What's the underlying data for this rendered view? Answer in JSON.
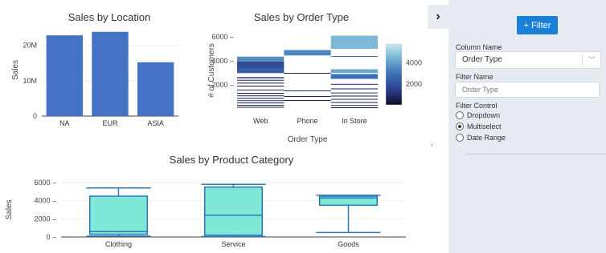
{
  "filter_panel": {
    "collapse_glyph": "›",
    "filter_button_label": "+ Filter",
    "column_name_label": "Column Name",
    "column_name_value": "Order Type",
    "filter_name_label": "Filter Name",
    "filter_name_placeholder": "Order Type",
    "filter_control_label": "Filter Control",
    "filter_controls": [
      {
        "label": "Dropdown",
        "selected": false
      },
      {
        "label": "Multiselect",
        "selected": true
      },
      {
        "label": "Date Range",
        "selected": false
      }
    ]
  },
  "chart_data": [
    {
      "type": "bar",
      "title": "Sales by Location",
      "ylabel": "Sales",
      "xlabel": "",
      "categories": [
        "NA",
        "EUR",
        "ASIA"
      ],
      "values": [
        22800000,
        23800000,
        15200000
      ],
      "ylim": [
        0,
        26000000
      ],
      "yticks": [
        0,
        10000000,
        20000000
      ],
      "ytick_labels": [
        "0",
        "10M",
        "20M"
      ],
      "color": "#4472c4"
    },
    {
      "type": "heatmap",
      "title": "Sales by Order Type",
      "xlabel": "Order Type",
      "ylabel": "# of Customers",
      "categories": [
        "Web",
        "Phone",
        "In Store"
      ],
      "ylim": [
        0,
        6400
      ],
      "yticks": [
        2000,
        4000,
        6000
      ],
      "ytick_labels": [
        "2000",
        "4000",
        "6000"
      ],
      "colorbar_ticks": [
        2000,
        4000
      ],
      "colorbar_range": [
        0,
        5800
      ],
      "colorscale": [
        "#0d0d2b",
        "#2c3f8c",
        "#3b6fb5",
        "#6fb0d1",
        "#c7e9f1"
      ],
      "cells": [
        {
          "col": 0,
          "y0": 3950,
          "y1": 4350,
          "value": 3600
        },
        {
          "col": 0,
          "y0": 3400,
          "y1": 3950,
          "value": 1800
        },
        {
          "col": 0,
          "y0": 2980,
          "y1": 3400,
          "value": 2400
        },
        {
          "col": 0,
          "y0": 2550,
          "y1": 2640,
          "value": 600
        },
        {
          "col": 0,
          "y0": 2350,
          "y1": 2420,
          "value": 900
        },
        {
          "col": 0,
          "y0": 2120,
          "y1": 2180,
          "value": 400
        },
        {
          "col": 0,
          "y0": 1860,
          "y1": 1930,
          "value": 500
        },
        {
          "col": 0,
          "y0": 1550,
          "y1": 1610,
          "value": 700
        },
        {
          "col": 0,
          "y0": 1280,
          "y1": 1330,
          "value": 300
        },
        {
          "col": 0,
          "y0": 1080,
          "y1": 1120,
          "value": 800
        },
        {
          "col": 0,
          "y0": 880,
          "y1": 910,
          "value": 400
        },
        {
          "col": 0,
          "y0": 690,
          "y1": 720,
          "value": 1100
        },
        {
          "col": 0,
          "y0": 500,
          "y1": 530,
          "value": 500
        },
        {
          "col": 0,
          "y0": 300,
          "y1": 330,
          "value": 900
        },
        {
          "col": 0,
          "y0": 140,
          "y1": 170,
          "value": 300
        },
        {
          "col": 1,
          "y0": 4450,
          "y1": 4900,
          "value": 3400
        },
        {
          "col": 1,
          "y0": 2960,
          "y1": 3000,
          "value": 700
        },
        {
          "col": 1,
          "y0": 1500,
          "y1": 1540,
          "value": 500
        },
        {
          "col": 1,
          "y0": 1040,
          "y1": 1070,
          "value": 400
        },
        {
          "col": 1,
          "y0": 700,
          "y1": 730,
          "value": 300
        },
        {
          "col": 2,
          "y0": 5000,
          "y1": 6100,
          "value": 4600
        },
        {
          "col": 2,
          "y0": 4350,
          "y1": 4400,
          "value": 3000
        },
        {
          "col": 2,
          "y0": 3000,
          "y1": 3300,
          "value": 4200
        },
        {
          "col": 2,
          "y0": 2500,
          "y1": 2900,
          "value": 2900
        },
        {
          "col": 2,
          "y0": 2020,
          "y1": 2080,
          "value": 900
        },
        {
          "col": 2,
          "y0": 1650,
          "y1": 1700,
          "value": 600
        },
        {
          "col": 2,
          "y0": 1300,
          "y1": 1360,
          "value": 1200
        },
        {
          "col": 2,
          "y0": 1040,
          "y1": 1100,
          "value": 400
        },
        {
          "col": 2,
          "y0": 780,
          "y1": 830,
          "value": 800
        },
        {
          "col": 2,
          "y0": 520,
          "y1": 570,
          "value": 500
        },
        {
          "col": 2,
          "y0": 280,
          "y1": 320,
          "value": 1000
        },
        {
          "col": 2,
          "y0": 90,
          "y1": 130,
          "value": 300
        }
      ]
    },
    {
      "type": "box",
      "title": "Sales by Product Category",
      "ylabel": "Sales",
      "xlabel": "",
      "categories": [
        "Clothing",
        "Service",
        "Goods"
      ],
      "boxes": [
        {
          "min": 100,
          "q1": 300,
          "median": 600,
          "q3": 4500,
          "max": 5400
        },
        {
          "min": 50,
          "q1": 200,
          "median": 2400,
          "q3": 5500,
          "max": 5800
        },
        {
          "min": 500,
          "q1": 3500,
          "median": 4300,
          "q3": 4500,
          "max": 4600
        }
      ],
      "ylim": [
        0,
        6000
      ],
      "yticks": [
        0,
        2000,
        4000,
        6000
      ],
      "ytick_labels": [
        "0",
        "2000",
        "4000",
        "6000"
      ],
      "fill": "#7fe8d6",
      "stroke": "#2a7ab8"
    }
  ]
}
